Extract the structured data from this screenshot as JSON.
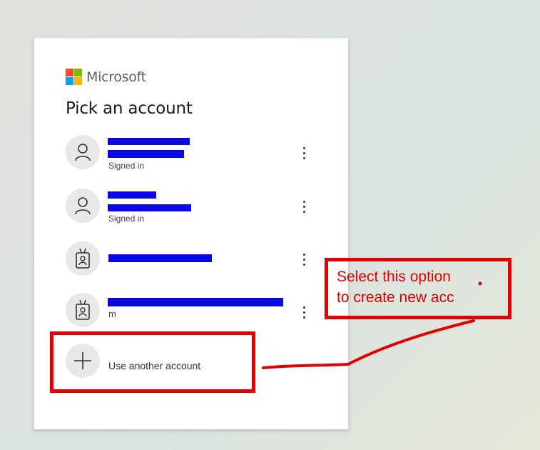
{
  "brand": {
    "name": "Microsoft",
    "logo_colors": [
      "#f25022",
      "#7fba00",
      "#00a4ef",
      "#ffb900"
    ]
  },
  "title": "Pick an account",
  "accounts": [
    {
      "avatar_icon": "person-icon",
      "line1": "",
      "line2": "",
      "status": "Signed in"
    },
    {
      "avatar_icon": "person-icon",
      "line1": "",
      "line2": "",
      "status": "Signed in"
    },
    {
      "avatar_icon": "work-badge-icon",
      "line1": "",
      "line2": "",
      "status": ""
    },
    {
      "avatar_icon": "work-badge-icon",
      "line1": "",
      "line2": "m",
      "status": ""
    }
  ],
  "use_another": {
    "icon": "plus-icon",
    "label": "Use another account"
  },
  "annotation": {
    "line1": "Select this option",
    "line2": "to create new acc",
    "color": "#e20000"
  },
  "redaction_color": "#0a07e8"
}
